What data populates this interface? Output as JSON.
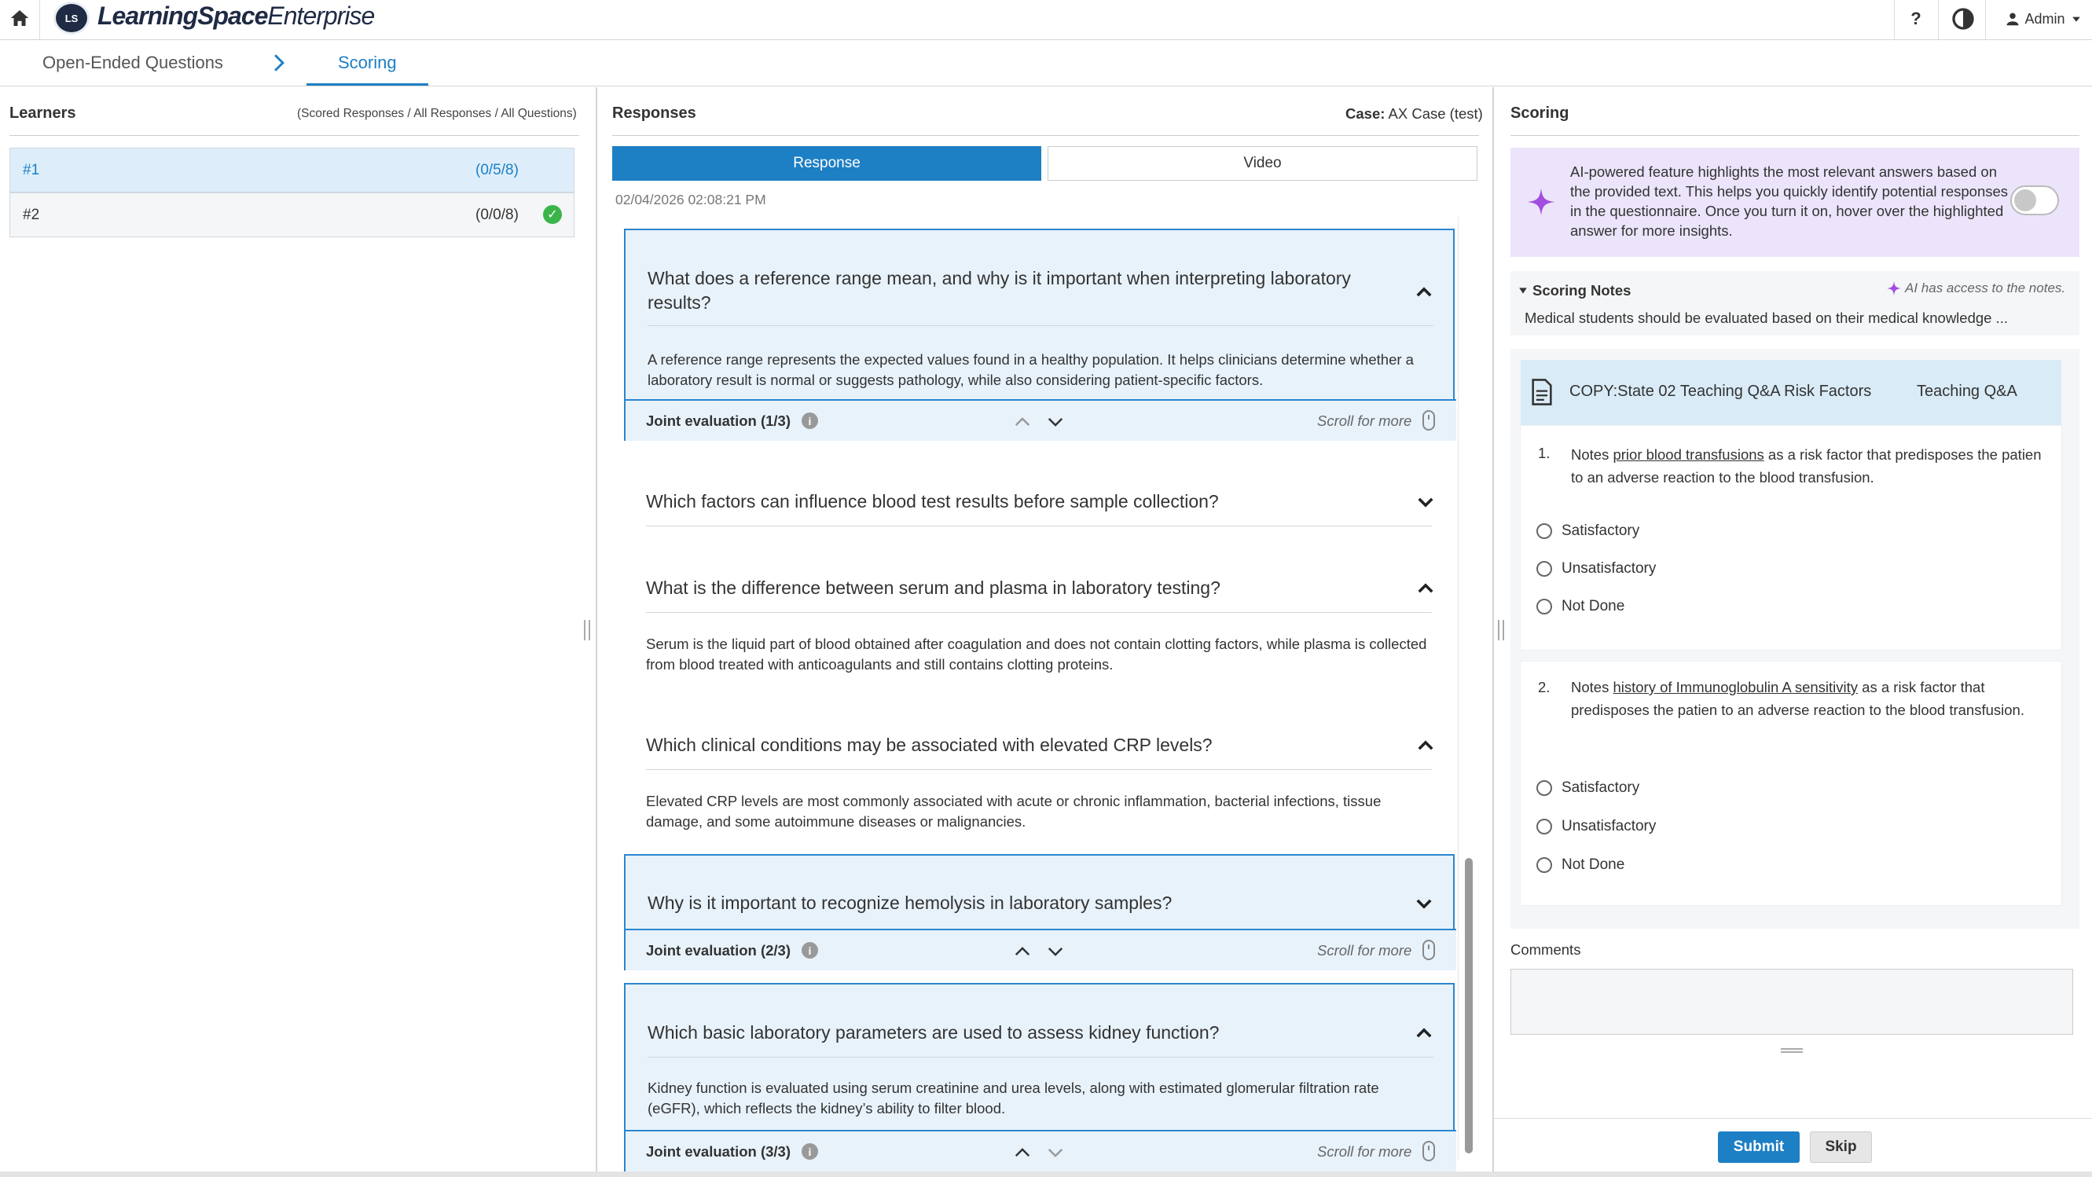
{
  "header": {
    "logo_initials": "LS",
    "brand_bold": "LearningSpace",
    "brand_light": "Enterprise",
    "help_label": "?",
    "user_label": "Admin"
  },
  "nav": {
    "tabs": [
      {
        "label": "Open-Ended Questions"
      },
      {
        "label": "Scoring"
      }
    ],
    "accent": "#1d7fc4"
  },
  "learners": {
    "title": "Learners",
    "legend": "(Scored Responses / All Responses / All Questions)",
    "rows": [
      {
        "id": "#1",
        "score": "(0/5/8)"
      },
      {
        "id": "#2",
        "score": "(0/0/8)"
      }
    ]
  },
  "responses": {
    "title": "Responses",
    "case_label": "Case:",
    "case_value": "AX Case (test)",
    "toggle": {
      "response": "Response",
      "video": "Video"
    },
    "timestamp": "02/04/2026 02:08:21 PM",
    "scroll_hint": "Scroll for more",
    "questions": [
      {
        "title": "What does a reference range mean, and why is it important when interpreting laboratory results?",
        "answer": "A reference range represents the expected values found in a healthy population. It helps clinicians determine whether a laboratory result is normal or suggests pathology, while also considering patient-specific factors.",
        "joint": "Joint evaluation (1/3)"
      },
      {
        "title": "Which factors can influence blood test results before sample collection?"
      },
      {
        "title": "What is the difference between serum and plasma in laboratory testing?",
        "answer": "Serum is the liquid part of blood obtained after coagulation and does not contain clotting factors, while plasma is collected from blood treated with anticoagulants and still contains clotting proteins."
      },
      {
        "title": "Which clinical conditions may be associated with elevated CRP levels?",
        "answer": "Elevated CRP levels are most commonly associated with acute or chronic inflammation, bacterial infections, tissue damage, and some autoimmune diseases or malignancies."
      },
      {
        "title": "Why is it important to recognize hemolysis in laboratory samples?",
        "joint": "Joint evaluation (2/3)"
      },
      {
        "title": "Which basic laboratory parameters are used to assess kidney function?",
        "answer": "Kidney function is evaluated using serum creatinine and urea levels, along with estimated glomerular filtration rate (eGFR), which reflects the kidney’s ability to filter blood.",
        "joint": "Joint evaluation (3/3)"
      }
    ]
  },
  "scoring": {
    "title": "Scoring",
    "ai_text": "AI-powered feature highlights the most relevant answers based on the provided text. This helps you quickly identify potential responses in the questionnaire. Once you turn it on, hover over the highlighted answer for more insights.",
    "ai_toggle_on": false,
    "notes_title": "Scoring Notes",
    "notes_ai": "AI has access to the notes.",
    "notes_text": "Medical students should be evaluated based on their medical knowledge ...",
    "item_title": "COPY:State 02 Teaching Q&A Risk Factors",
    "item_type": "Teaching Q&A",
    "items": [
      {
        "num": "1.",
        "pre": "Notes ",
        "link": "prior blood transfusions",
        "post": " as a risk factor that predisposes the patien to an adverse reaction to the blood transfusion.",
        "options": [
          "Satisfactory",
          "Unsatisfactory",
          "Not Done"
        ]
      },
      {
        "num": "2.",
        "pre": "Notes ",
        "link": "history of Immunoglobulin A sensitivity",
        "post": " as a risk factor that predisposes the patien to an adverse reaction to the blood transfusion.",
        "options": [
          "Satisfactory",
          "Unsatisfactory",
          "Not Done"
        ]
      }
    ],
    "comments_label": "Comments",
    "submit": "Submit",
    "skip": "Skip",
    "ai_color": "#a24de0"
  }
}
